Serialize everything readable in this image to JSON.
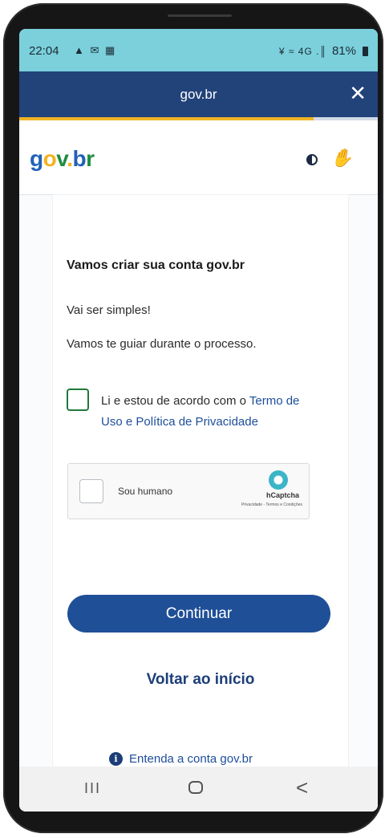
{
  "status_bar": {
    "time": "22:04",
    "notification_icons": "▲ ✉ ▦",
    "signal_icons": "¥ ≈ 4G .║",
    "battery": "81%"
  },
  "titlebar": {
    "title": "gov.br",
    "close_label": "✕"
  },
  "header": {
    "logo_parts": [
      "g",
      "o",
      "v",
      ".",
      "b",
      "r"
    ],
    "contrast_icon": "contrast-icon",
    "accessibility_icon": "libras-hand-icon"
  },
  "card": {
    "heading": "Vamos criar sua conta gov.br",
    "line1": "Vai ser simples!",
    "line2": "Vamos te guiar durante o processo.",
    "terms_prefix": "Li e estou de acordo com o",
    "terms_link": "Termo de Uso e Política de Privacidade",
    "captcha_label": "Sou humano",
    "captcha_brand": "hCaptcha",
    "captcha_links": "Privacidade - Termos e Condições",
    "continue_label": "Continuar",
    "back_label": "Voltar ao início",
    "info_label": "Entenda a conta gov.br",
    "info_icon_glyph": "i"
  },
  "navbar": {
    "recent_glyph": "III",
    "back_glyph": "<"
  },
  "colors": {
    "status_bar": "#7bd0dc",
    "titlebar": "#22427a",
    "primary_button": "#1f4f97",
    "link": "#1d4e9a",
    "checkbox_border": "#1f7a3a"
  }
}
